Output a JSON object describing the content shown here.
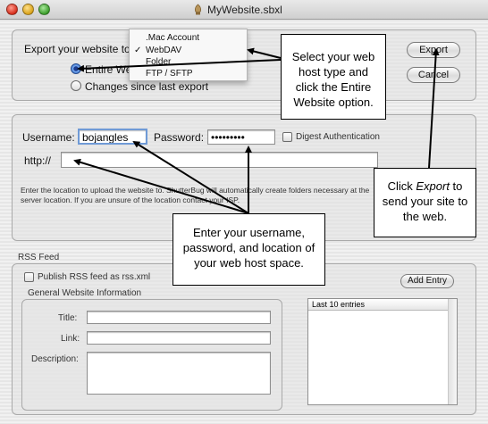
{
  "window": {
    "title": "MyWebsite.sbxl"
  },
  "export_section": {
    "prompt_label": "Export your website to",
    "popup_selected": "WebDAV",
    "menu_items": [
      ".Mac Account",
      "WebDAV",
      "Folder",
      "FTP / SFTP"
    ],
    "radio_entire": "Entire We",
    "radio_changes": "Changes since last export",
    "export_button": "Export",
    "cancel_button": "Cancel"
  },
  "credentials": {
    "username_label": "Username:",
    "username_value": "bojangles",
    "password_label": "Password:",
    "password_value": "•••••••••",
    "digest_label": "Digest Authentication",
    "http_label": "http://",
    "http_value": "",
    "help_text": "Enter the location to upload the website to.  ShutterBug will automatically create folders necessary at the server location.  If you are unsure of the location contact your ISP."
  },
  "rss": {
    "section_label": "RSS Feed",
    "publish_label": "Publish RSS feed as rss.xml",
    "general_label": "General Website Information",
    "title_label": "Title:",
    "link_label": "Link:",
    "description_label": "Description:",
    "add_entry_button": "Add Entry",
    "list_header": "Last 10 entries"
  },
  "callouts": {
    "web_host": "Select your web host type and click the Entire Website option.",
    "credentials_pre": "Enter your username, password, and location of your web host space.",
    "export_pre": "Click ",
    "export_em": "Export",
    "export_post": " to send your site to the web."
  },
  "colors": {
    "accent": "#2a67c9",
    "callout_border": "#000000"
  }
}
